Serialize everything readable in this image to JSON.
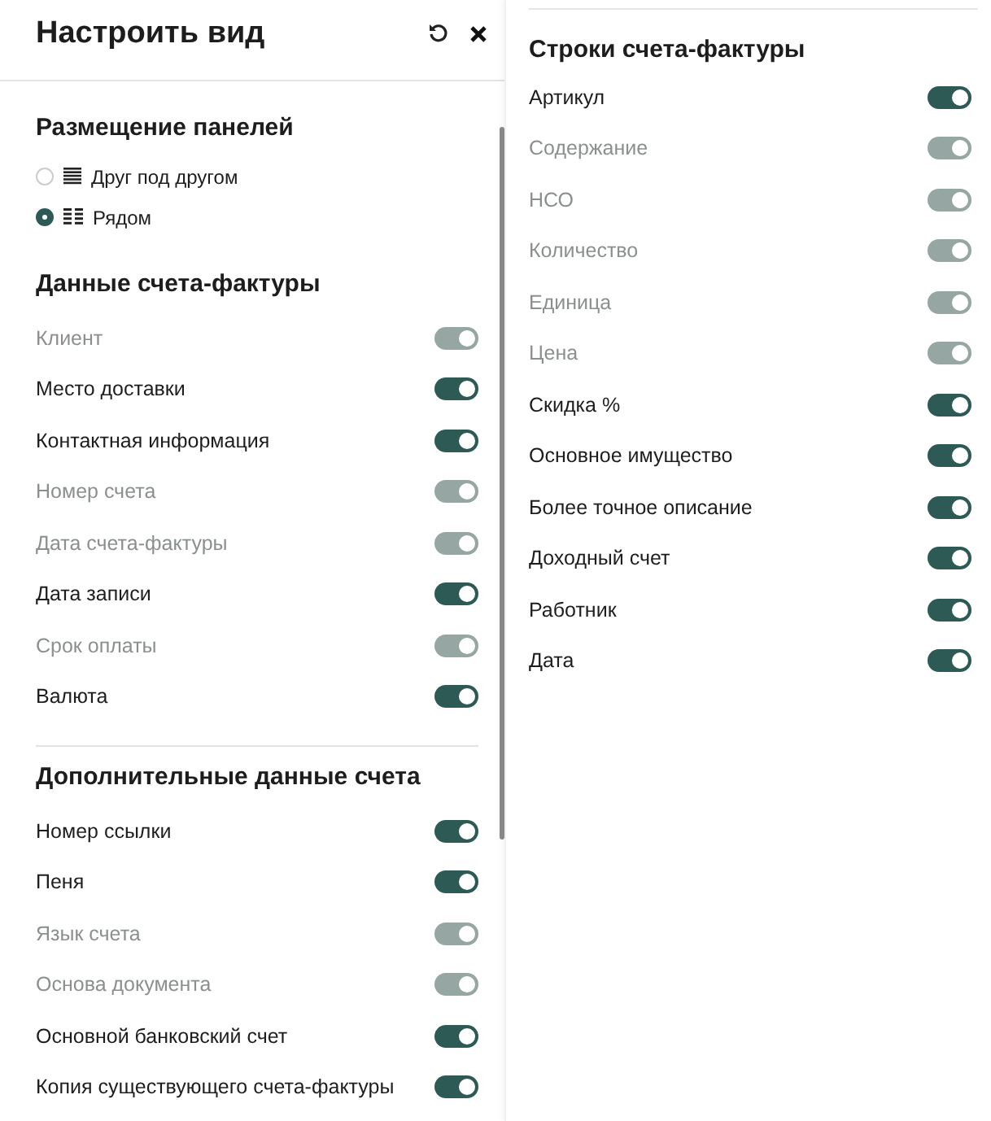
{
  "header": {
    "title": "Настроить вид"
  },
  "layout_section": {
    "title": "Размещение панелей",
    "options": [
      {
        "label": "Друг под другом",
        "kind": "stacked",
        "selected": false
      },
      {
        "label": "Рядом",
        "kind": "columns",
        "selected": true
      }
    ]
  },
  "left_sections": [
    {
      "title": "Данные счета-фактуры",
      "items": [
        {
          "label": "Клиент",
          "on": true,
          "disabled": true
        },
        {
          "label": "Место доставки",
          "on": true,
          "disabled": false
        },
        {
          "label": "Контактная информация",
          "on": true,
          "disabled": false
        },
        {
          "label": "Номер счета",
          "on": true,
          "disabled": true
        },
        {
          "label": "Дата счета-фактуры",
          "on": true,
          "disabled": true
        },
        {
          "label": "Дата записи",
          "on": true,
          "disabled": false
        },
        {
          "label": "Срок оплаты",
          "on": true,
          "disabled": true
        },
        {
          "label": "Валюта",
          "on": true,
          "disabled": false
        }
      ]
    },
    {
      "title": "Дополнительные данные счета",
      "items": [
        {
          "label": "Номер ссылки",
          "on": true,
          "disabled": false
        },
        {
          "label": "Пеня",
          "on": true,
          "disabled": false
        },
        {
          "label": "Язык счета",
          "on": true,
          "disabled": true
        },
        {
          "label": "Основа документа",
          "on": true,
          "disabled": true
        },
        {
          "label": "Основной банковский счет",
          "on": true,
          "disabled": false
        },
        {
          "label": "Копия существующего счета-фактуры",
          "on": true,
          "disabled": false
        }
      ]
    }
  ],
  "right_section": {
    "title": "Строки счета-фактуры",
    "items": [
      {
        "label": "Артикул",
        "on": true,
        "disabled": false
      },
      {
        "label": "Содержание",
        "on": true,
        "disabled": true
      },
      {
        "label": "НСО",
        "on": true,
        "disabled": true
      },
      {
        "label": "Количество",
        "on": true,
        "disabled": true
      },
      {
        "label": "Единица",
        "on": true,
        "disabled": true
      },
      {
        "label": "Цена",
        "on": true,
        "disabled": true
      },
      {
        "label": "Скидка %",
        "on": true,
        "disabled": false
      },
      {
        "label": "Основное имущество",
        "on": true,
        "disabled": false
      },
      {
        "label": "Более точное описание",
        "on": true,
        "disabled": false
      },
      {
        "label": "Доходный счет",
        "on": true,
        "disabled": false
      },
      {
        "label": "Работник",
        "on": true,
        "disabled": false
      },
      {
        "label": "Дата",
        "on": true,
        "disabled": false
      }
    ]
  }
}
